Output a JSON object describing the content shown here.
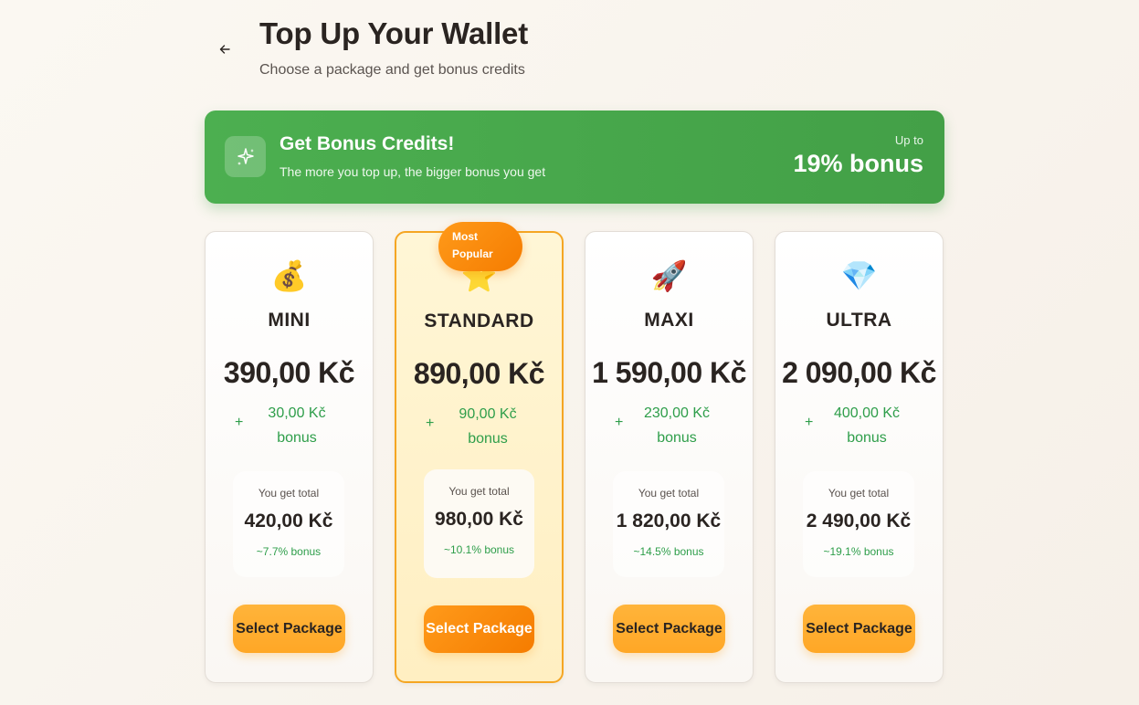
{
  "header": {
    "back_icon": "arrow-left-icon",
    "title": "Top Up Your Wallet",
    "subtitle": "Choose a package and get bonus credits"
  },
  "banner": {
    "icon": "sparkles-icon",
    "title": "Get Bonus Credits!",
    "subtitle": "The more you top up, the bigger bonus you get",
    "upto_label": "Up to",
    "max_bonus": "19% bonus",
    "color": "#4caf50"
  },
  "packages": [
    {
      "icon": "💰",
      "icon_name": "money-bag-icon",
      "name": "MINI",
      "price": "390,00 Kč",
      "plus": "+",
      "bonus_amount": "30,00 Kč",
      "bonus_word": "bonus",
      "total_label": "You get total",
      "total_value": "420,00 Kč",
      "total_pct": "~7.7% bonus",
      "button_label": "Select Package",
      "popular": false
    },
    {
      "icon": "⭐",
      "icon_name": "star-icon",
      "name": "STANDARD",
      "price": "890,00 Kč",
      "plus": "+",
      "bonus_amount": "90,00 Kč",
      "bonus_word": "bonus",
      "total_label": "You get total",
      "total_value": "980,00 Kč",
      "total_pct": "~10.1% bonus",
      "button_label": "Select Package",
      "popular": true,
      "badge_line1": "Most",
      "badge_line2": "Popular"
    },
    {
      "icon": "🚀",
      "icon_name": "rocket-icon",
      "name": "MAXI",
      "price": "1 590,00 Kč",
      "plus": "+",
      "bonus_amount": "230,00 Kč",
      "bonus_word": "bonus",
      "total_label": "You get total",
      "total_value": "1 820,00 Kč",
      "total_pct": "~14.5% bonus",
      "button_label": "Select Package",
      "popular": false
    },
    {
      "icon": "💎",
      "icon_name": "diamond-icon",
      "name": "ULTRA",
      "price": "2 090,00 Kč",
      "plus": "+",
      "bonus_amount": "400,00 Kč",
      "bonus_word": "bonus",
      "total_label": "You get total",
      "total_value": "2 490,00 Kč",
      "total_pct": "~19.1% bonus",
      "button_label": "Select Package",
      "popular": false
    }
  ],
  "colors": {
    "accent_orange": "#f57c00",
    "button_orange": "#ffa726",
    "bonus_green": "#2e9e4a",
    "popular_border": "#f5a623"
  }
}
